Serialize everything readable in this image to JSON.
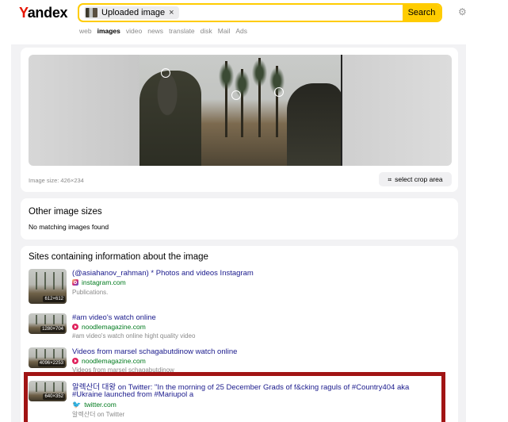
{
  "header": {
    "logo": "Yandex",
    "search_chip_label": "Uploaded image",
    "search_chip_close": "×",
    "search_button": "Search",
    "tabs": [
      "web",
      "images",
      "video",
      "news",
      "translate",
      "disk",
      "Mail",
      "Ads"
    ],
    "active_tab": "images"
  },
  "image_panel": {
    "size_label": "Image size: 426×234",
    "crop_button": "select crop area"
  },
  "other_sizes": {
    "title": "Other image sizes",
    "message": "No matching images found"
  },
  "sites": {
    "title": "Sites containing information about the image",
    "results": [
      {
        "title": "(@asiahanov_rahman) * Photos and videos Instagram",
        "domain": "instagram.com",
        "description": "Publications.",
        "resolution": "612×612",
        "icon": "instagram-icon"
      },
      {
        "title": "#am video's watch online",
        "domain": "noodlemagazine.com",
        "description": "#am video's watch online hight quality video",
        "resolution": "1280×704",
        "icon": "play-icon"
      },
      {
        "title": "Videos from marsel schagabutdinow watch online",
        "domain": "noodlemagazine.com",
        "description": "Videos from marsel schagabutdinow",
        "resolution": "4096×2253",
        "icon": "play-icon"
      },
      {
        "title_line1": "알렉산더 대왕 on Twitter: \"In the morning of 25 December Grads of f&cking raguls of #Country404 aka",
        "title_line2": "#Ukraine launched from #Mariupol a",
        "domain": "twitter.com",
        "description": "알렉산더 on Twitter",
        "resolution": "640×352",
        "icon": "twitter-icon"
      }
    ]
  },
  "colors": {
    "accent": "#ffcc00",
    "link": "#1a1a8c",
    "domain": "#007a1e",
    "highlight_border": "#a11414"
  }
}
